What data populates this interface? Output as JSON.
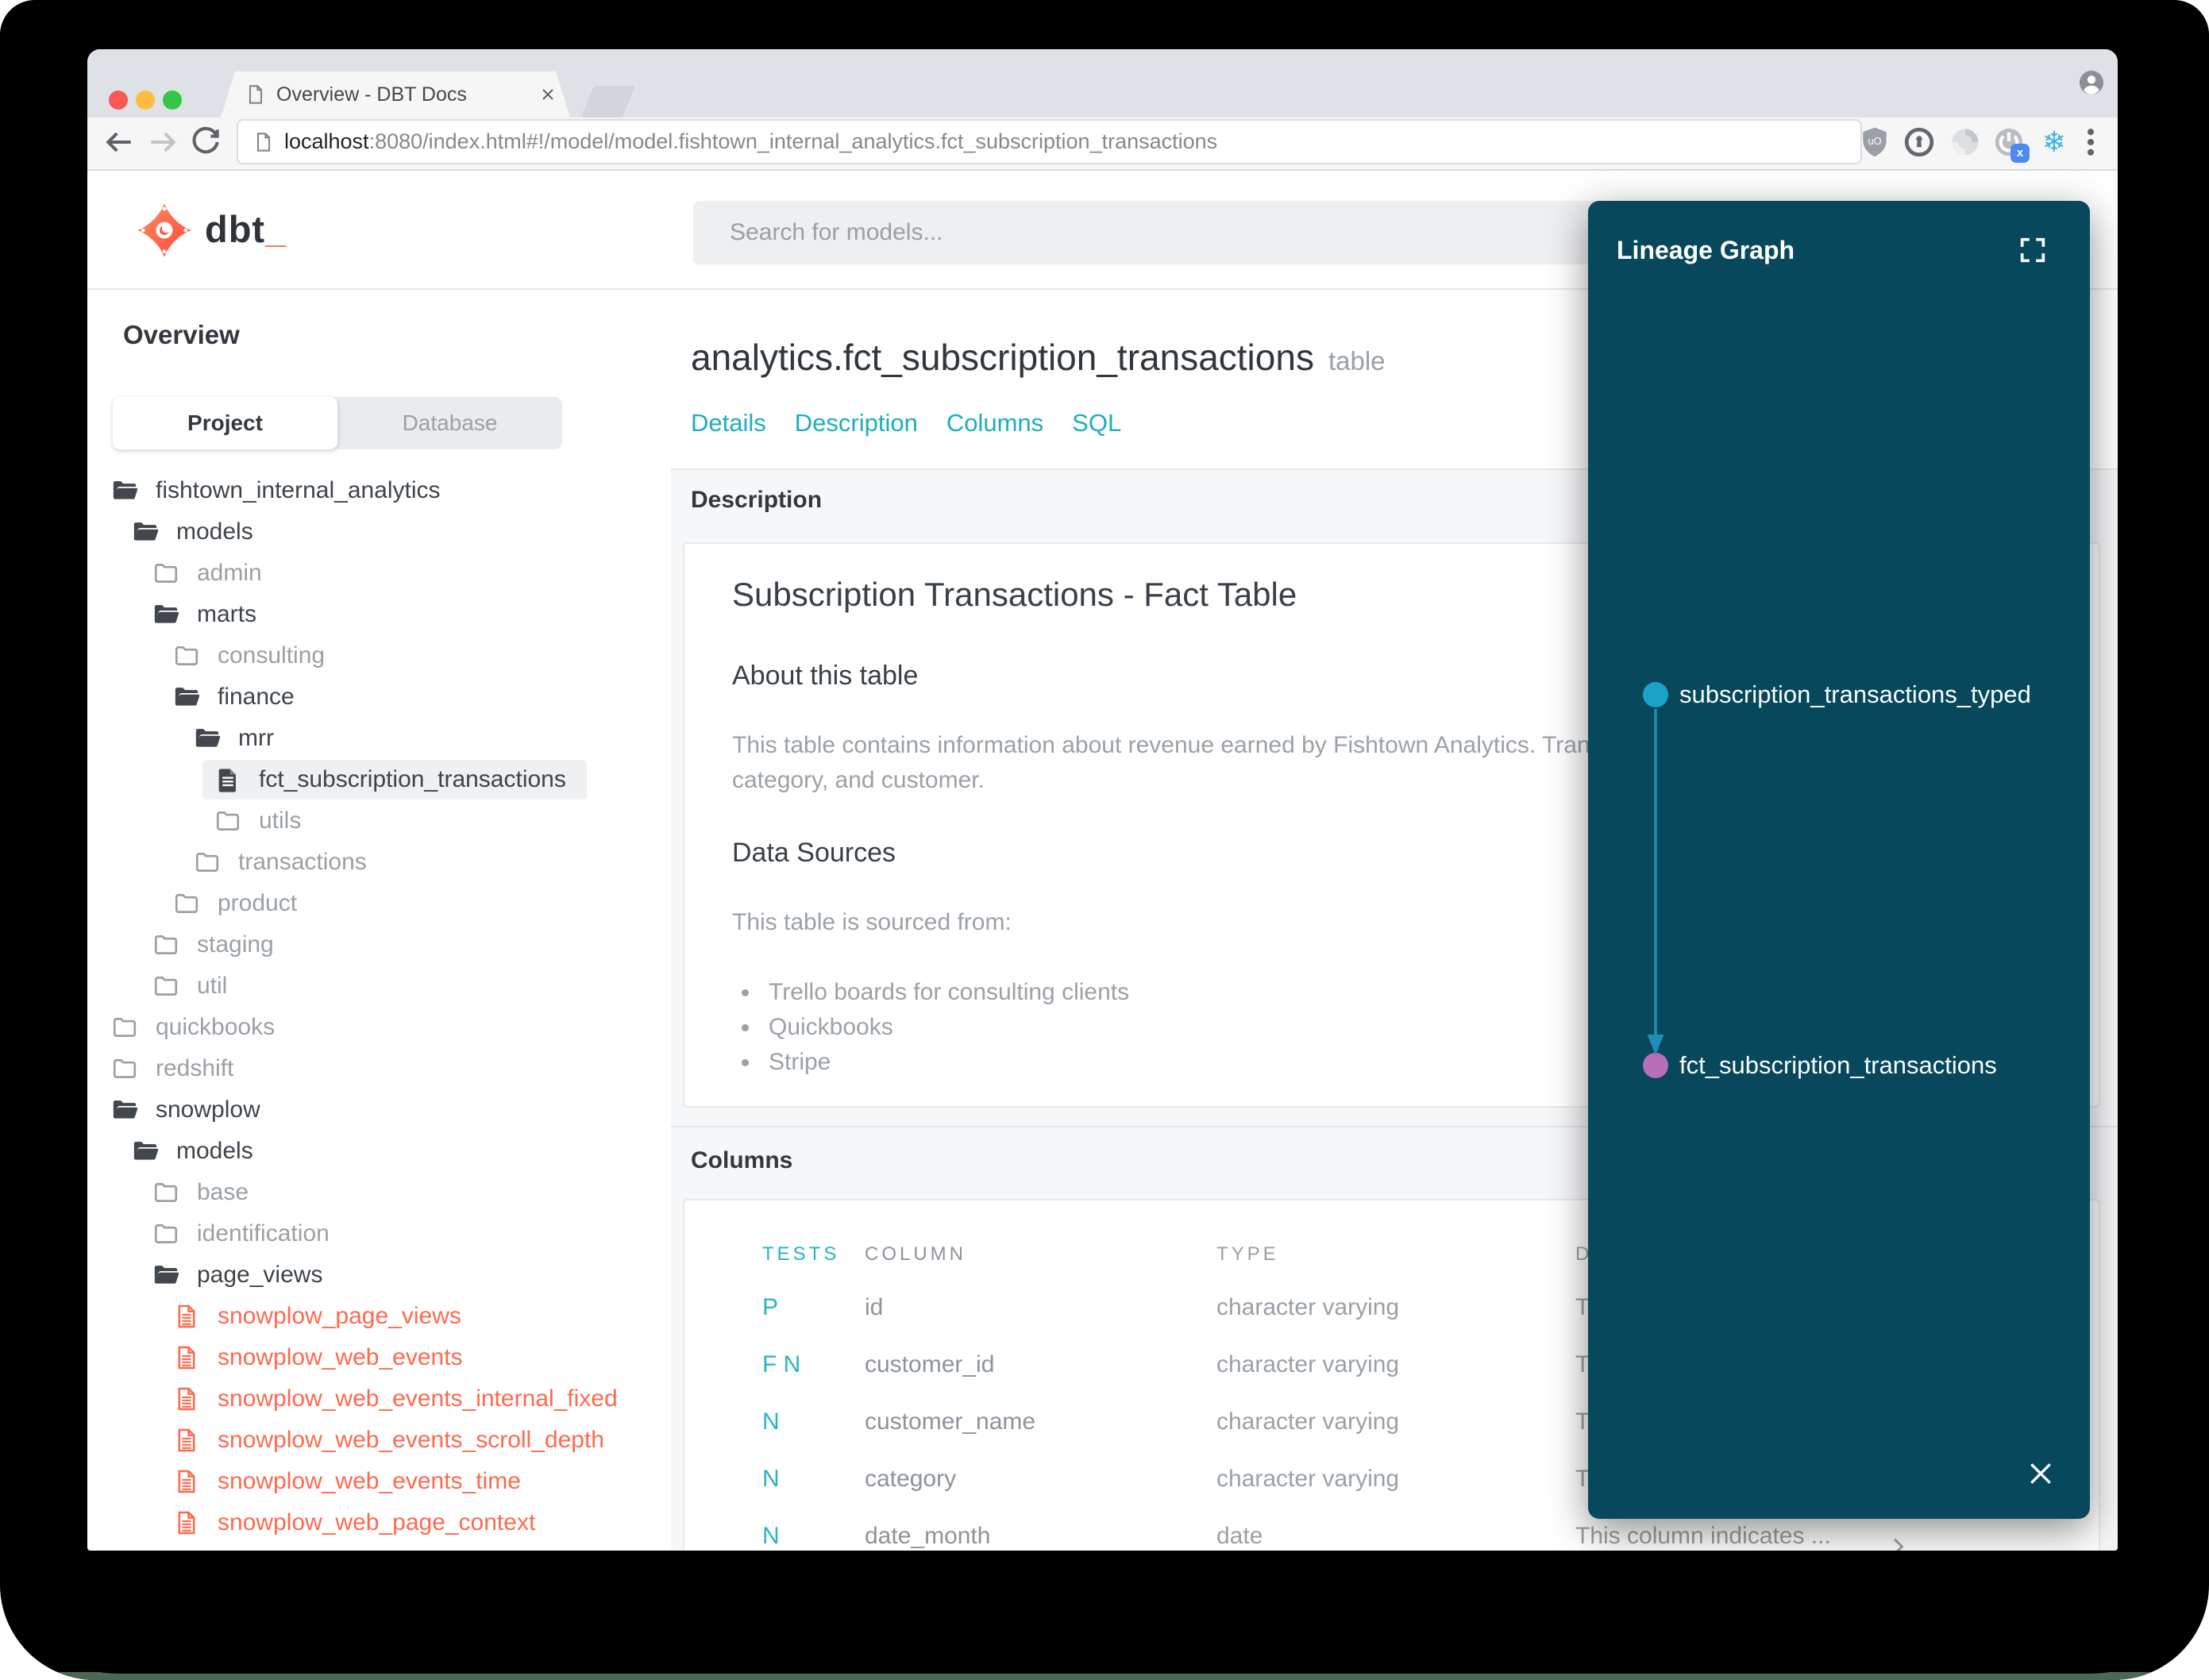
{
  "browser": {
    "tab_title": "Overview - DBT Docs",
    "url": {
      "host": "localhost",
      "rest": ":8080/index.html#!/model/model.fishtown_internal_analytics.fct_subscription_transactions"
    }
  },
  "header": {
    "logo_text": "dbt",
    "logo_cursor": "_",
    "search_placeholder": "Search for models..."
  },
  "sidebar": {
    "heading": "Overview",
    "toggle": {
      "active": "Project",
      "inactive": "Database"
    },
    "tree": [
      {
        "label": "fishtown_internal_analytics",
        "level": 0,
        "icon": "folder-open",
        "variant": "dark"
      },
      {
        "label": "models",
        "level": 1,
        "icon": "folder-open",
        "variant": "dark"
      },
      {
        "label": "admin",
        "level": 2,
        "icon": "folder",
        "variant": "gray"
      },
      {
        "label": "marts",
        "level": 2,
        "icon": "folder-open",
        "variant": "dark"
      },
      {
        "label": "consulting",
        "level": 3,
        "icon": "folder",
        "variant": "gray"
      },
      {
        "label": "finance",
        "level": 3,
        "icon": "folder-open",
        "variant": "dark"
      },
      {
        "label": "mrr",
        "level": 4,
        "icon": "folder-open",
        "variant": "dark"
      },
      {
        "label": "fct_subscription_transactions",
        "level": 5,
        "icon": "file",
        "variant": "dark",
        "selected": true
      },
      {
        "label": "utils",
        "level": 5,
        "icon": "folder",
        "variant": "gray"
      },
      {
        "label": "transactions",
        "level": 4,
        "icon": "folder",
        "variant": "gray"
      },
      {
        "label": "product",
        "level": 3,
        "icon": "folder",
        "variant": "gray"
      },
      {
        "label": "staging",
        "level": 2,
        "icon": "folder",
        "variant": "gray"
      },
      {
        "label": "util",
        "level": 2,
        "icon": "folder",
        "variant": "gray"
      },
      {
        "label": "quickbooks",
        "level": 0,
        "icon": "folder",
        "variant": "gray"
      },
      {
        "label": "redshift",
        "level": 0,
        "icon": "folder",
        "variant": "gray"
      },
      {
        "label": "snowplow",
        "level": 0,
        "icon": "folder-open",
        "variant": "dark"
      },
      {
        "label": "models",
        "level": 1,
        "icon": "folder-open",
        "variant": "dark"
      },
      {
        "label": "base",
        "level": 2,
        "icon": "folder",
        "variant": "gray"
      },
      {
        "label": "identification",
        "level": 2,
        "icon": "folder",
        "variant": "gray"
      },
      {
        "label": "page_views",
        "level": 2,
        "icon": "folder-open",
        "variant": "dark"
      },
      {
        "label": "snowplow_page_views",
        "level": 3,
        "icon": "file",
        "variant": "orange"
      },
      {
        "label": "snowplow_web_events",
        "level": 3,
        "icon": "file",
        "variant": "orange"
      },
      {
        "label": "snowplow_web_events_internal_fixed",
        "level": 3,
        "icon": "file",
        "variant": "orange"
      },
      {
        "label": "snowplow_web_events_scroll_depth",
        "level": 3,
        "icon": "file",
        "variant": "orange"
      },
      {
        "label": "snowplow_web_events_time",
        "level": 3,
        "icon": "file",
        "variant": "orange"
      },
      {
        "label": "snowplow_web_page_context",
        "level": 3,
        "icon": "file",
        "variant": "orange"
      }
    ]
  },
  "model": {
    "title": "analytics.fct_subscription_transactions",
    "badge": "table",
    "tabs": [
      "Details",
      "Description",
      "Columns",
      "SQL"
    ]
  },
  "description": {
    "section_heading": "Description",
    "doc_title": "Subscription Transactions - Fact Table",
    "about_heading": "About this table",
    "about_text_line1": "This table contains information about revenue earned by Fishtown Analytics. Trans",
    "about_text_line2": "category, and customer.",
    "sources_heading": "Data Sources",
    "sources_intro": "This table is sourced from:",
    "sources": [
      "Trello boards for consulting clients",
      "Quickbooks",
      "Stripe"
    ]
  },
  "columns": {
    "section_heading": "Columns",
    "headers": [
      "TESTS",
      "COLUMN",
      "TYPE",
      "DESCRIPTION"
    ],
    "rows": [
      {
        "tests": "P",
        "column": "id",
        "type": "character varying",
        "description": "T",
        "expandable": false
      },
      {
        "tests": "F N",
        "column": "customer_id",
        "type": "character varying",
        "description": "T",
        "expandable": false
      },
      {
        "tests": "N",
        "column": "customer_name",
        "type": "character varying",
        "description": "T",
        "expandable": false
      },
      {
        "tests": "N",
        "column": "category",
        "type": "character varying",
        "description": "T",
        "expandable": false
      },
      {
        "tests": "N",
        "column": "date_month",
        "type": "date",
        "description": "This column indicates ...",
        "expandable": true
      }
    ]
  },
  "lineage": {
    "title": "Lineage Graph",
    "nodes": [
      {
        "label": "subscription_transactions_typed",
        "color": "#1ba2c8"
      },
      {
        "label": "fct_subscription_transactions",
        "color": "#b66fb8"
      }
    ],
    "edge": {
      "from": "subscription_transactions_typed",
      "to": "fct_subscription_transactions",
      "color": "#1f8fb4"
    }
  },
  "colors": {
    "accent_teal": "#1caebe",
    "test_teal": "#29b5bc",
    "dbt_orange": "#ff694e",
    "lineage_bg": "#07485c",
    "node_blue": "#1ba2c8",
    "node_purple": "#b66fb8"
  },
  "icons": {
    "tab_favicon": "document-icon",
    "navigation": [
      "back-arrow-icon",
      "forward-arrow-icon",
      "refresh-icon"
    ],
    "extensions": [
      "ublock-shield-icon",
      "onepassword-icon",
      "swirl-icon",
      "power-x-icon",
      "snowflake-icon",
      "kebab-menu-icon"
    ],
    "lineage": [
      "expand-icon",
      "close-icon"
    ],
    "tree": [
      "folder-open-icon",
      "folder-icon",
      "document-icon"
    ]
  }
}
